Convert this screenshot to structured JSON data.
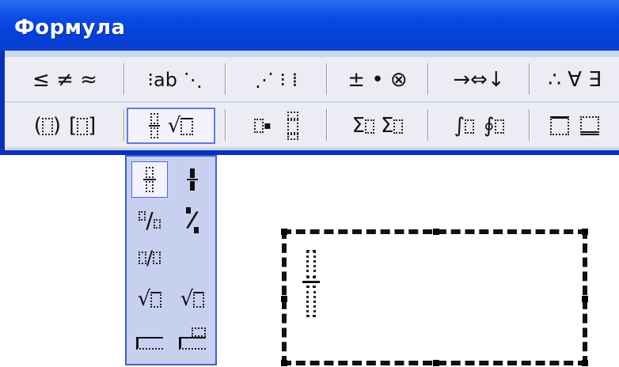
{
  "window": {
    "title": "Формула"
  },
  "toolbar": {
    "row1": [
      {
        "name": "relations-group",
        "label": "≤≠≈"
      },
      {
        "name": "spaces-ellipses-group",
        "label": "⁝ ab ⋱"
      },
      {
        "name": "embellishments-group",
        "label": "⋰ ⁝ ⁞"
      },
      {
        "name": "operators-group",
        "label": "± • ⊗"
      },
      {
        "name": "arrows-group",
        "label": "→ ⇔ ↓"
      },
      {
        "name": "logic-group",
        "label": "∴ ∀ ∃"
      }
    ],
    "row2": [
      {
        "name": "fences-group",
        "label": "(⁝) [⁝]"
      },
      {
        "name": "fractions-radicals-group",
        "label": "√"
      },
      {
        "name": "scripts-group",
        "label": ""
      },
      {
        "name": "summation-group",
        "label": "Σ Σ"
      },
      {
        "name": "integrals-group",
        "label": "∫ ∮"
      },
      {
        "name": "bars-group",
        "label": ""
      }
    ]
  },
  "palette": {
    "items": [
      {
        "name": "full-fraction-template",
        "selected": true
      },
      {
        "name": "small-fraction-template",
        "selected": false
      },
      {
        "name": "slash-fraction-template",
        "label": "/"
      },
      {
        "name": "small-slash-fraction-template",
        "label": "⁄"
      },
      {
        "name": "baseline-slash-template",
        "label": "/"
      },
      {
        "name": "square-root-template",
        "label": "√"
      },
      {
        "name": "nth-root-template",
        "label": "√"
      },
      {
        "name": "long-division-template",
        "label": ""
      },
      {
        "name": "long-division-quotient-template",
        "label": ""
      }
    ]
  },
  "equation": {
    "content": "fraction with empty numerator and denominator"
  }
}
